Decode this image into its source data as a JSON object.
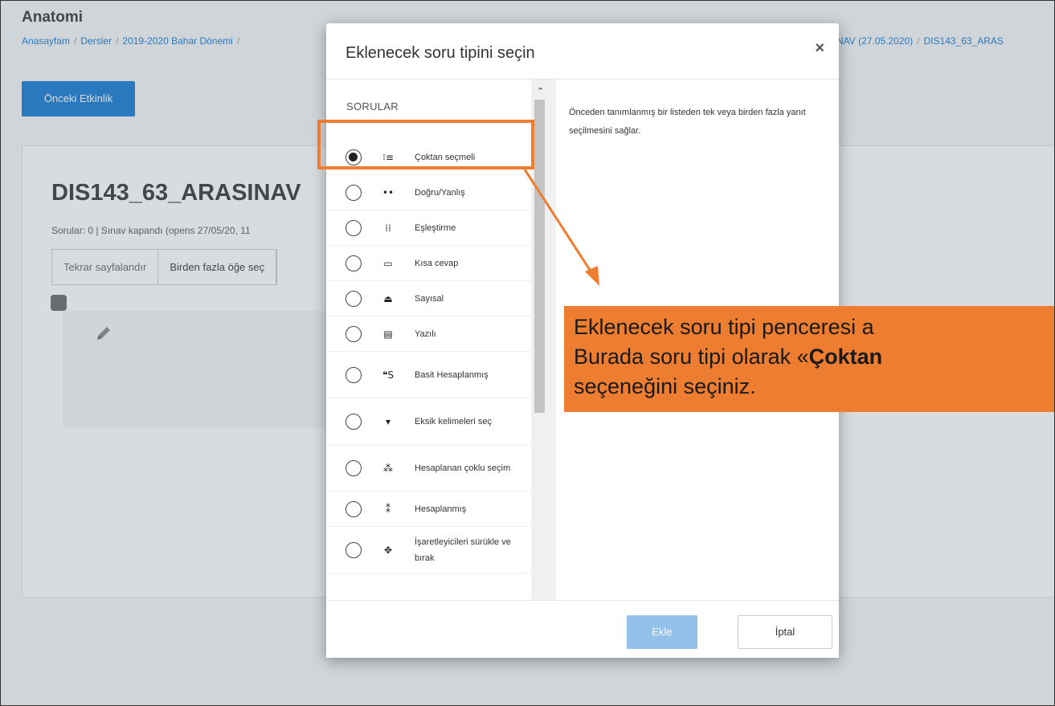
{
  "page": {
    "course_title": "Anatomi",
    "breadcrumb": [
      "Anasayfam",
      "Dersler",
      "2019-2020 Bahar Dönemi"
    ],
    "breadcrumb_right": [
      "NAV (27.05.2020)",
      "DIS143_63_ARAS"
    ],
    "prev_button": "Önceki Etkinlik",
    "quiz_title": "DIS143_63_ARASINAV",
    "quiz_info": "Sorular: 0 | Sınav kapandı (opens 27/05/20, 11",
    "repaginate_button": "Tekrar sayfalandır",
    "select_multiple_button": "Birden fazla öğe seç"
  },
  "modal": {
    "title": "Eklenecek soru tipini seçin",
    "close_label": "×",
    "section_header": "SORULAR",
    "selected_index": 0,
    "items": [
      {
        "label": "Çoktan seçmeli",
        "icon": "multichoice-icon",
        "glyph": "⁝≡"
      },
      {
        "label": "Doğru/Yanlış",
        "icon": "truefalse-icon",
        "glyph": "••"
      },
      {
        "label": "Eşleştirme",
        "icon": "matching-icon",
        "glyph": "⁞⁞"
      },
      {
        "label": "Kısa cevap",
        "icon": "shortanswer-icon",
        "glyph": "▭"
      },
      {
        "label": "Sayısal",
        "icon": "numerical-icon",
        "glyph": "⏏"
      },
      {
        "label": "Yazılı",
        "icon": "essay-icon",
        "glyph": "▤"
      },
      {
        "label": "Basit Hesaplanmış",
        "icon": "calculatedsimple-icon",
        "glyph": "❝S"
      },
      {
        "label": "Eksik kelimeleri seç",
        "icon": "gapselect-icon",
        "glyph": "▾"
      },
      {
        "label": "Hesaplanan çoklu seçim",
        "icon": "calculatedmulti-icon",
        "glyph": "⁂"
      },
      {
        "label": "Hesaplanmış",
        "icon": "calculated-icon",
        "glyph": "⁑"
      },
      {
        "label": "İşaretleyicileri sürükle ve bırak",
        "icon": "ddmarker-icon",
        "glyph": "✥"
      }
    ],
    "description": "Önceden tanımlanmış bir listeden tek veya birden fazla yanıt seçilmesini sağlar.",
    "add_button": "Ekle",
    "cancel_button": "İptal"
  },
  "annotation": {
    "line1": "Eklenecek soru tipi penceresi a",
    "line2_prefix": "Burada soru tipi olarak «",
    "line2_bold": "Çoktan",
    "line3": "seçeneğini seçiniz."
  },
  "colors": {
    "accent": "#1177d1",
    "annotation": "#ed7d31",
    "add_button_disabled": "#94c1ea"
  }
}
